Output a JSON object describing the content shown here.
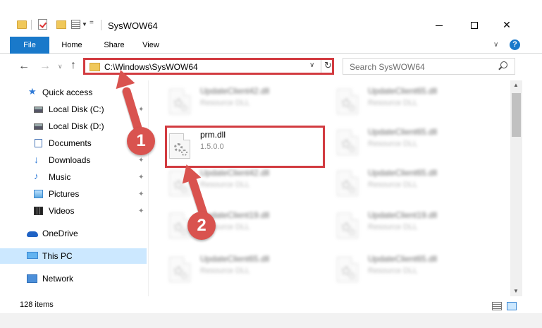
{
  "window": {
    "title": "SysWOW64",
    "minimize": "",
    "maximize": "",
    "close": "✕"
  },
  "ribbon": {
    "tabs": [
      {
        "label": "File"
      },
      {
        "label": "Home"
      },
      {
        "label": "Share"
      },
      {
        "label": "View"
      }
    ],
    "help": "?"
  },
  "address": {
    "path": "C:\\Windows\\SysWOW64"
  },
  "search": {
    "placeholder": "Search SysWOW64"
  },
  "sidebar": {
    "items": [
      {
        "label": "Quick access",
        "icon": "star-icon"
      },
      {
        "label": "Local Disk (C:)",
        "icon": "drive-icon",
        "pinned": true
      },
      {
        "label": "Local Disk (D:)",
        "icon": "drive-icon"
      },
      {
        "label": "Documents",
        "icon": "documents-icon",
        "pinned": true
      },
      {
        "label": "Downloads",
        "icon": "downloads-icon",
        "pinned": true
      },
      {
        "label": "Music",
        "icon": "music-icon",
        "pinned": true
      },
      {
        "label": "Pictures",
        "icon": "pictures-icon",
        "pinned": true
      },
      {
        "label": "Videos",
        "icon": "videos-icon",
        "pinned": true
      },
      {
        "label": "OneDrive",
        "icon": "onedrive-icon"
      },
      {
        "label": "This PC",
        "icon": "this-pc-icon",
        "selected": true
      },
      {
        "label": "Network",
        "icon": "network-icon"
      }
    ]
  },
  "files": [
    {
      "name": "UpdateClient42.dll",
      "desc": "Resource DLL"
    },
    {
      "name": "UpdateClient65.dll",
      "desc": "Resource DLL"
    },
    {
      "name": "prm.dll",
      "desc": "1.5.0.0"
    },
    {
      "name": "UpdateClient65.dll",
      "desc": "Resource DLL"
    },
    {
      "name": "UpdateClient42.dll",
      "desc": "Resource DLL"
    },
    {
      "name": "UpdateClient65.dll",
      "desc": "Resource DLL"
    },
    {
      "name": "UpdateClient19.dll",
      "desc": "Resource DLL"
    },
    {
      "name": "UpdateClient19.dll",
      "desc": "Resource DLL"
    },
    {
      "name": "UpdateClient65.dll",
      "desc": "Resource DLL"
    },
    {
      "name": "UpdateClient65.dll",
      "desc": "Resource DLL"
    }
  ],
  "status": {
    "item_count": "128 items"
  },
  "annotations": {
    "badge1": "1",
    "badge2": "2"
  },
  "colors": {
    "accent": "#1979ca",
    "highlight": "#d23b40",
    "selected": "#cce8ff",
    "annotation": "#d9534f"
  }
}
